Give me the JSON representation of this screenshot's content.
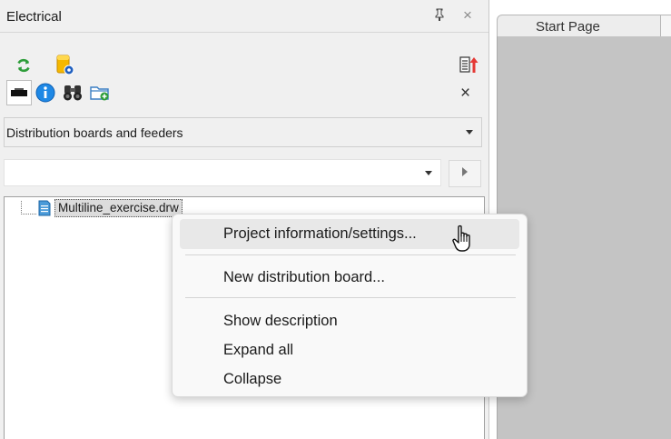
{
  "panel": {
    "title": "Electrical",
    "pin_glyph": "⍐",
    "close_glyph": "×",
    "toolbar_close_glyph": "×"
  },
  "dropdown": {
    "selected": "Distribution boards and feeders"
  },
  "search": {
    "value": "",
    "placeholder": ""
  },
  "tree": {
    "items": [
      {
        "label": "Multiline_exercise.drw"
      }
    ]
  },
  "context_menu": {
    "items": [
      "Project information/settings...",
      "New distribution board...",
      "Show description",
      "Expand all",
      "Collapse"
    ]
  },
  "tabs": [
    {
      "label": "Start Page"
    }
  ],
  "colors": {
    "panel_bg": "#f0f0f0",
    "document_area": "#c4c4c4",
    "info_blue": "#1e88e5",
    "refresh_green": "#2e9d3a",
    "export_red": "#e53935"
  },
  "icons": [
    "refresh-icon",
    "database-settings-icon",
    "export-list-icon",
    "monitor-icon",
    "info-icon",
    "binoculars-icon",
    "new-folder-icon",
    "arrow-right-icon",
    "document-icon",
    "hand-cursor-icon"
  ]
}
